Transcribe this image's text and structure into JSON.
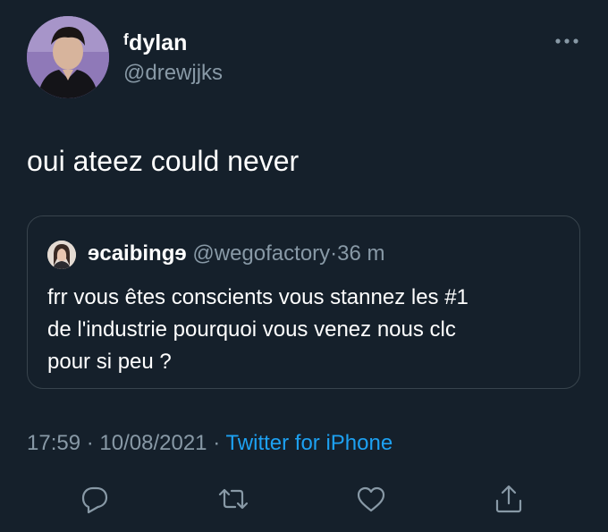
{
  "author": {
    "display_name": "ᶠdylan",
    "handle": "@drewjjks"
  },
  "tweet": {
    "text": "oui ateez could never"
  },
  "quoted_tweet": {
    "display_name": "ɘcaibingɘ",
    "handle": "@wegofactory",
    "separator": "·",
    "time": "36 m",
    "body_lines": [
      "frr vous êtes conscients vous stannez les #1",
      "de l'industrie pourquoi vous venez nous clc",
      "pour si peu ?"
    ]
  },
  "meta": {
    "time": "17:59",
    "separator1": "·",
    "date": "10/08/2021",
    "separator2": "·",
    "source": "Twitter for iPhone"
  },
  "actions": {
    "icons": [
      "reply-icon",
      "retweet-icon",
      "like-icon",
      "share-icon"
    ]
  },
  "colors": {
    "background": "#15202b",
    "primary_text": "#ffffff",
    "secondary_text": "#8899a6",
    "link": "#1da1f2",
    "border": "#38444d"
  }
}
